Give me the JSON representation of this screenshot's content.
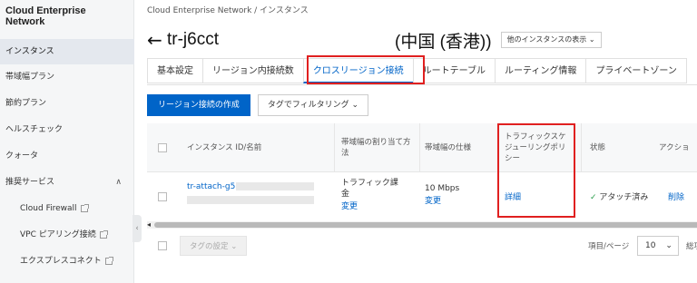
{
  "sidebar": {
    "brand_line1": "Cloud Enterprise",
    "brand_line2": "Network",
    "items": [
      {
        "label": "インスタンス"
      },
      {
        "label": "帯域幅プラン"
      },
      {
        "label": "節約プラン"
      },
      {
        "label": "ヘルスチェック"
      },
      {
        "label": "クォータ"
      },
      {
        "label": "推奨サービス"
      }
    ],
    "sub_items": [
      {
        "label": "Cloud Firewall"
      },
      {
        "label": "VPC ピアリング接続"
      },
      {
        "label": "エクスプレスコネクト"
      }
    ],
    "collapse_glyph": "‹",
    "expand_glyph": "∧"
  },
  "breadcrumb": "Cloud Enterprise Network / インスタンス",
  "title": {
    "back_glyph": "←",
    "prefix": "tr-j6cct",
    "suffix": "(中国 (香港))",
    "region_select": "他のインスタンスの表示"
  },
  "tabs": [
    {
      "label": "基本設定"
    },
    {
      "label": "リージョン内接続数"
    },
    {
      "label": "クロスリージョン接続"
    },
    {
      "label": "ルートテーブル"
    },
    {
      "label": "ルーティング情報"
    },
    {
      "label": "プライベートゾーン"
    }
  ],
  "toolbar": {
    "create_label": "リージョン接続の作成",
    "filter_label": "タグでフィルタリング"
  },
  "table": {
    "headers": {
      "instance": "インスタンス ID/名前",
      "alloc": "帯域幅の割り当て方法",
      "spec": "帯域幅の仕様",
      "policy": "トラフィックスケジューリングポリシー",
      "status": "状態",
      "action": "アクショ"
    },
    "row": {
      "instance_id": "tr-attach-g5",
      "alloc_line1": "トラフィック課金",
      "alloc_link": "変更",
      "spec": "10 Mbps",
      "spec_link": "変更",
      "policy_link": "詳細",
      "status": "アタッチ済み",
      "action": "削除"
    }
  },
  "footer": {
    "tag_settings": "タグの設定",
    "page_size_label": "項目/ページ",
    "page_size": "10",
    "total_label": "総項"
  }
}
